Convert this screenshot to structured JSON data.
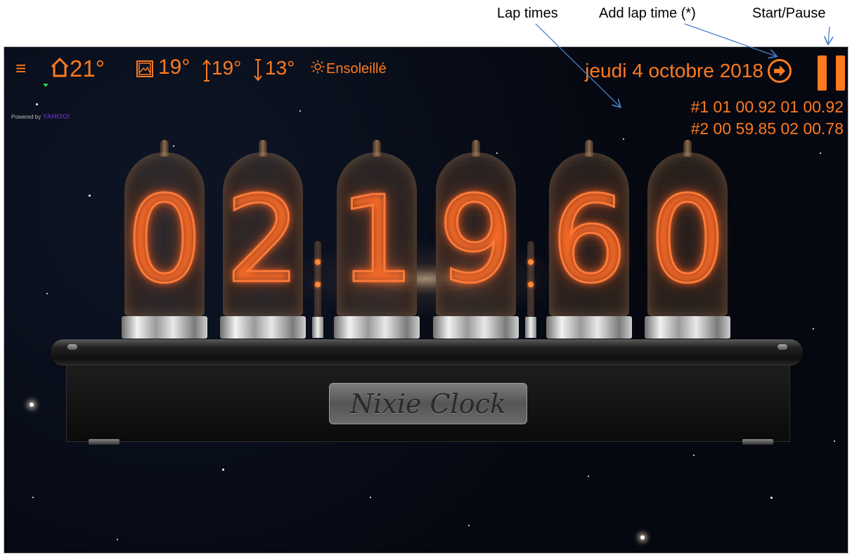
{
  "annotations": {
    "lap_times": "Lap times",
    "add_lap_time": "Add lap time (*)",
    "start_pause": "Start/Pause"
  },
  "topbar": {
    "menu_icon": "hamburger-menu-icon",
    "inside_temp": "21°",
    "outside_temp": "19°",
    "max_temp": "19°",
    "min_temp": "13°",
    "weather": "Ensoleillé",
    "powered_by": "Powered by",
    "provider": "YAHOO!"
  },
  "date": "jeudi 4 octobre 2018",
  "laps": [
    "#2 00 59.85 02 00.78",
    "#1 01 00.92 01 00.92"
  ],
  "display": {
    "digits": [
      "0",
      "2",
      "1",
      "9",
      "6",
      "0"
    ]
  },
  "nameplate": "Nixie Clock",
  "colors": {
    "accent": "#ff7a1f",
    "background": "#05070d",
    "nixie_glow": "#ff7a3a"
  }
}
